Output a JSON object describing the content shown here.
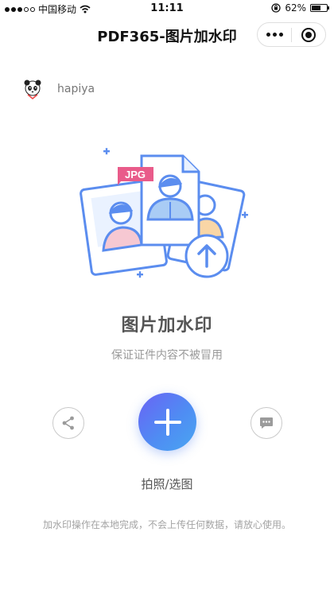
{
  "status_bar": {
    "carrier": "中国移动",
    "time": "11:11",
    "battery": "62%",
    "battery_level": 0.62,
    "icons": [
      "signal-dots-icon",
      "wifi-icon",
      "rotation-lock-icon",
      "battery-icon"
    ]
  },
  "nav": {
    "title": "PDF365-图片加水印",
    "capsule_icons": [
      "more-icon",
      "close-target-icon"
    ]
  },
  "user": {
    "name": "hapiya",
    "avatar_icon": "panda-avatar-icon"
  },
  "illustration": {
    "badge": "JPG",
    "icons": [
      "photo-card-icon",
      "document-icon",
      "upload-arrow-icon"
    ]
  },
  "main": {
    "title": "图片加水印",
    "subtitle": "保证证件内容不被冒用",
    "add_label": "拍照/选图",
    "footer_note": "加水印操作在本地完成，不会上传任何数据，请放心使用。"
  },
  "actions": {
    "share_icon": "share-icon",
    "add_icon": "plus-icon",
    "chat_icon": "chat-bubble-icon"
  },
  "colors": {
    "primary_blue": "#5B8DEF",
    "gradient_start": "#6A63F5",
    "gradient_end": "#49A6F2",
    "badge_pink": "#E95B8A",
    "text_gray": "#555555",
    "hint_gray": "#A3A3A3"
  }
}
